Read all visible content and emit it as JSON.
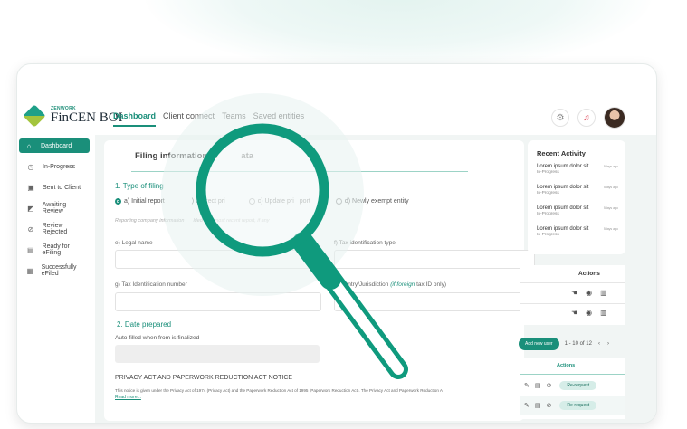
{
  "brand": {
    "small": "ZENWORK",
    "name": "FinCEN BOI"
  },
  "nav": [
    "Dashboard",
    "Client connect",
    "Teams",
    "Saved entities"
  ],
  "icons": {
    "settings": "gear-icon",
    "notifications": "bell-icon"
  },
  "sidebar": [
    {
      "label": "Dashboard",
      "icon": "⌂"
    },
    {
      "label": "In-Progress",
      "icon": "◷"
    },
    {
      "label": "Sent to Client",
      "icon": "▣"
    },
    {
      "label": "Awaiting Review",
      "icon": "◩"
    },
    {
      "label": "Review Rejected",
      "icon": "⊘"
    },
    {
      "label": "Ready for eFiling",
      "icon": "▤"
    },
    {
      "label": "Successfully eFiled",
      "icon": "▦"
    }
  ],
  "form": {
    "title": "Filing information fil",
    "title_tail": "ata",
    "section1": "1. Type of filing",
    "radios": [
      "a) Initial report",
      ") Correct pri",
      "c) Update pri",
      "port",
      "d) Newly exempt entity"
    ],
    "note": "Reporting company information",
    "note_tail": "lded with most recent report, if any",
    "legal_name": "e) Legal name",
    "tax_type": "f) Tax identification type",
    "tax_number": "g) Tax Identification number",
    "jurisdiction": "ountry/Jurisdiction",
    "jurisdiction_note": "(if foreign",
    "jurisdiction_tail": "tax ID only)",
    "section2": "2. Date prepared",
    "auto_filled": "Auto-filled when from is finalized",
    "privacy_title": "PRIVACY ACT AND PAPERWORK REDUCTION ACT NOTICE",
    "privacy_text": "This notice is given under the Privacy Act of 1974 (Privacy Act) and the Paperwork Reduction Act of 1995 (Paperwork Reduction Act). The Privacy Act and Paperwork Reduction A",
    "read_more": "Read more..."
  },
  "recent": {
    "title": "Recent Activity",
    "items": [
      {
        "title": "Lorem ipsum dolor sit",
        "status": "In-Progress",
        "time": "5days ago"
      },
      {
        "title": "Lorem ipsum dolor sit",
        "status": "In-Progress",
        "time": "5days ago"
      },
      {
        "title": "Lorem ipsum dolor sit",
        "status": "In-Progress",
        "time": "5days ago"
      },
      {
        "title": "Lorem ipsum dolor sit",
        "status": "In-Progress",
        "time": "5days ago"
      }
    ]
  },
  "table1": {
    "actions": "Actions"
  },
  "pagination": {
    "add": "Add new user",
    "range": "1 - 10 of 12"
  },
  "table2": {
    "actions": "Actions",
    "rerequest": "Re-request"
  },
  "colors": {
    "accent": "#1a8f7a",
    "glass_ring": "#0f9a7d"
  }
}
